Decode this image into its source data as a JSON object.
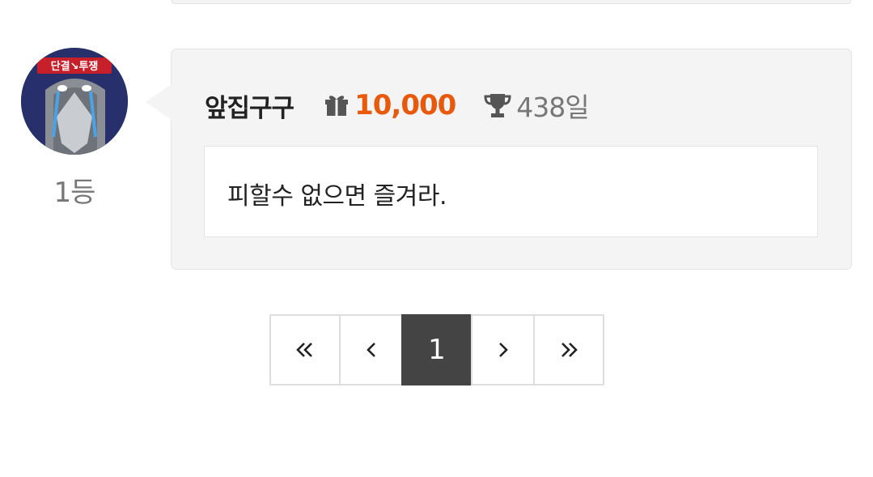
{
  "comment": {
    "author": "앞집구구",
    "points": "10,000",
    "days": "438일",
    "rank": "1등",
    "text": "피할수 없으면 즐겨라.",
    "avatar_banner_text": "단결↘투쟁"
  },
  "pagination": {
    "current_page": "1",
    "buttons": [
      "first-page",
      "previous-page",
      "1",
      "next-page",
      "last-page"
    ]
  },
  "icons": {
    "gift": "gift-icon",
    "trophy": "trophy-icon",
    "first": "double-chevron-left-icon",
    "prev": "chevron-left-icon",
    "next": "chevron-right-icon",
    "last": "double-chevron-right-icon"
  },
  "colors": {
    "points": "#e8590c",
    "card_background": "#f4f4f4",
    "active_page": "#444444",
    "muted_text": "#777777"
  }
}
